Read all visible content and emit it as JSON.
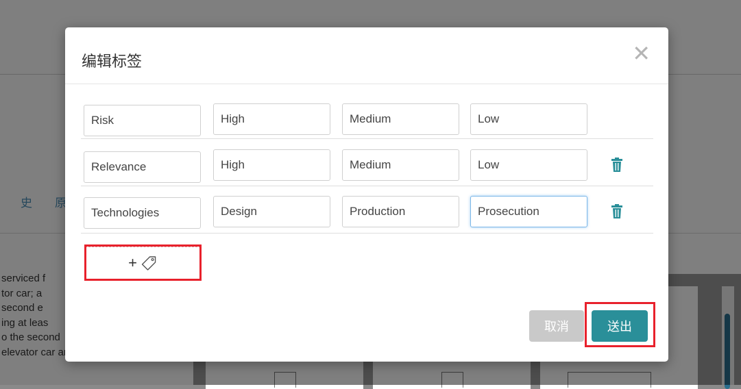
{
  "dialog": {
    "title": "编辑标签",
    "close_glyph": "✕",
    "rows": [
      {
        "cells": [
          "Risk",
          "High",
          "Medium",
          "Low"
        ],
        "deletable": false
      },
      {
        "cells": [
          "Relevance",
          "High",
          "Medium",
          "Low"
        ],
        "deletable": true
      },
      {
        "cells": [
          "Technologies",
          "Design",
          "Production",
          "Prosecution"
        ],
        "deletable": true,
        "focused_cell": 3
      }
    ],
    "add_button": {
      "plus": "+",
      "icon": "tag-icon"
    },
    "cancel_label": "取消",
    "submit_label": "送出"
  },
  "background": {
    "tab1": "史",
    "tab2": "原",
    "text_lines": [
      "serviced f",
      "tor car; a",
      "second e",
      "ing at leas",
      "o the second",
      "elevator car and the"
    ]
  },
  "colors": {
    "accent": "#2a8f99",
    "trash": "#2a8f99",
    "highlight": "#e8212c",
    "cancel": "#c9c9c9"
  }
}
